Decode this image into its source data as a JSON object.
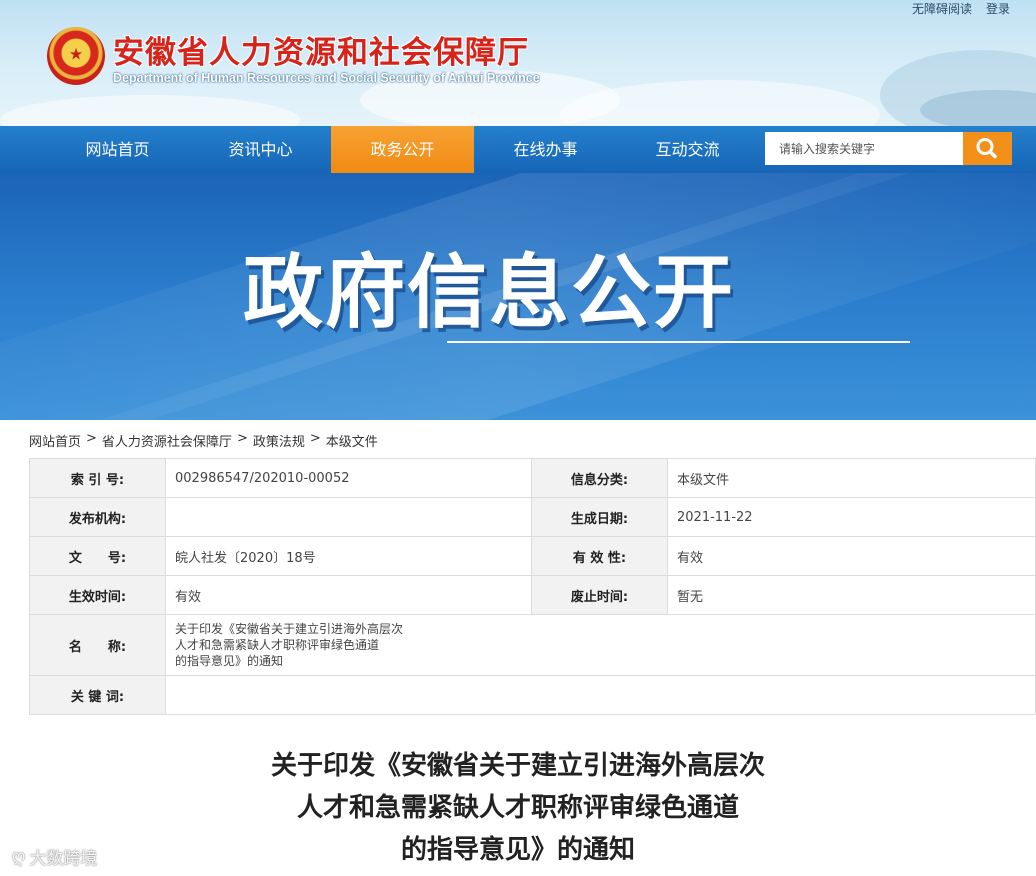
{
  "header": {
    "site_title": "安徽省人力资源和社会保障厅",
    "site_subtitle": "Department of Human Resources and Social Security of Anhui Province",
    "top_links": [
      "无障碍阅读",
      "登录"
    ]
  },
  "nav": {
    "items": [
      {
        "label": "网站首页",
        "active": false
      },
      {
        "label": "资讯中心",
        "active": false
      },
      {
        "label": "政务公开",
        "active": true
      },
      {
        "label": "在线办事",
        "active": false
      },
      {
        "label": "互动交流",
        "active": false
      }
    ],
    "search_placeholder": "请输入搜索关键字"
  },
  "banner": {
    "title": "政府信息公开"
  },
  "breadcrumb": {
    "items": [
      "网站首页",
      "省人力资源社会保障厅",
      "政策法规",
      "本级文件"
    ],
    "separator": ">"
  },
  "info": {
    "index_label": "索 引 号:",
    "index_value": "002986547/202010-00052",
    "category_label": "信息分类:",
    "category_value": "本级文件",
    "publisher_label": "发布机构:",
    "publisher_value": "",
    "date_label": "生成日期:",
    "date_value": "2021-11-22",
    "docno_label": "文　　号:",
    "docno_value": "皖人社发〔2020〕18号",
    "validity_label": "有 效 性:",
    "validity_value": "有效",
    "effective_label": "生效时间:",
    "effective_value": "有效",
    "expire_label": "废止时间:",
    "expire_value": "暂无",
    "name_label": "名　　称:",
    "name_value_lines": [
      "关于印发《安徽省关于建立引进海外高层次",
      "人才和急需紧缺人才职称评审绿色通道",
      "的指导意见》的通知"
    ],
    "keywords_label": "关 键 词:",
    "keywords_value": ""
  },
  "document": {
    "title_lines": [
      "关于印发《安徽省关于建立引进海外高层次",
      "人才和急需紧缺人才职称评审绿色通道",
      "的指导意见》的通知"
    ]
  },
  "watermark": {
    "text": "大数跨境"
  },
  "colors": {
    "nav_blue": "#1b6fc2",
    "nav_active_orange": "#f39019",
    "title_red": "#d6241a",
    "banner_blue": "#2c80cf"
  }
}
